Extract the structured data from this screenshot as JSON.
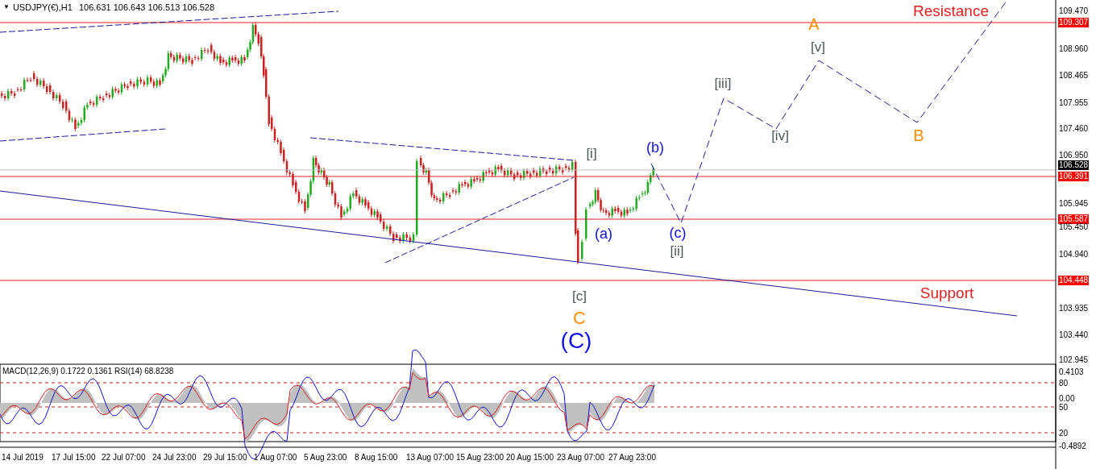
{
  "header": {
    "caret": "▼",
    "symbol": "USDJPY(€),H1",
    "quote": "106.631 106.643 106.513 106.528"
  },
  "wave_labels": [
    {
      "text": "A",
      "color": "#ff8c00"
    },
    {
      "text": "[v]",
      "color": "#4a5a5a"
    },
    {
      "text": "[iii]",
      "color": "#4a5a5a"
    },
    {
      "text": "[iv]",
      "color": "#4a5a5a"
    },
    {
      "text": "B",
      "color": "#ff8c00"
    },
    {
      "text": "(b)",
      "color": "#1010e0"
    },
    {
      "text": "[i]",
      "color": "#4a5a5a"
    },
    {
      "text": "(a)",
      "color": "#1010e0"
    },
    {
      "text": "(c)",
      "color": "#1010e0"
    },
    {
      "text": "[ii]",
      "color": "#4a5a5a"
    },
    {
      "text": "[c]",
      "color": "#4a5a5a"
    },
    {
      "text": "C",
      "color": "#ff8c00"
    },
    {
      "text": "(C)",
      "color": "#1010e0"
    }
  ],
  "zone_labels": [
    {
      "text": "Resistance"
    },
    {
      "text": "Support"
    }
  ],
  "price_axis": [
    {
      "text": "109.470",
      "kind": "tick"
    },
    {
      "text": "109.307",
      "kind": "level"
    },
    {
      "text": "108.960",
      "kind": "tick"
    },
    {
      "text": "108.465",
      "kind": "tick"
    },
    {
      "text": "107.955",
      "kind": "tick"
    },
    {
      "text": "107.460",
      "kind": "tick"
    },
    {
      "text": "106.950",
      "kind": "tick"
    },
    {
      "text": "106.528",
      "kind": "current"
    },
    {
      "text": "106.391",
      "kind": "level"
    },
    {
      "text": "105.945",
      "kind": "tick"
    },
    {
      "text": "105.587",
      "kind": "level"
    },
    {
      "text": "105.450",
      "kind": "tick"
    },
    {
      "text": "104.940",
      "kind": "tick"
    },
    {
      "text": "104.448",
      "kind": "level"
    },
    {
      "text": "103.935",
      "kind": "tick"
    },
    {
      "text": "103.440",
      "kind": "tick"
    },
    {
      "text": "102.945",
      "kind": "tick"
    }
  ],
  "indicator": {
    "title": "MACD(12,26,9) 0.1722 0.1361  RSI(14) 68.8238",
    "axis": [
      "0.4103",
      "80",
      "0.00",
      "50",
      "20",
      "-0.4892"
    ]
  },
  "time_axis": [
    "14 Jul 2019",
    "17 Jul 15:00",
    "22 Jul 07:00",
    "24 Jul 23:00",
    "29 Jul 15:00",
    "1 Aug 07:00",
    "5 Aug 23:00",
    "8 Aug 15:00",
    "13 Aug 07:00",
    "15 Aug 23:00",
    "20 Aug 15:00",
    "23 Aug 07:00",
    "27 Aug 23:00"
  ]
}
